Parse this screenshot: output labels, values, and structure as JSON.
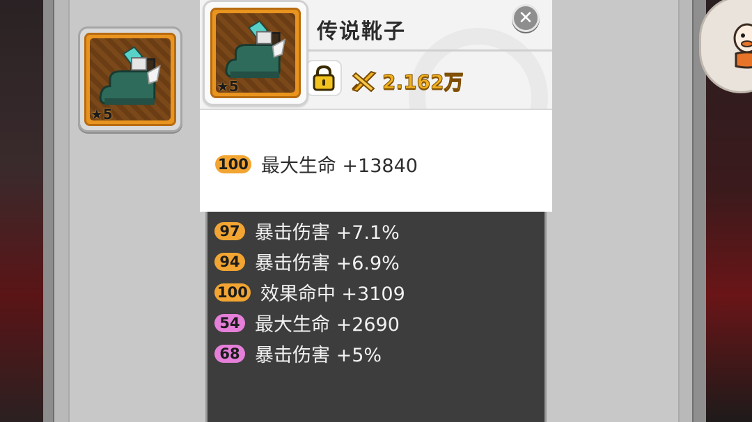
{
  "item": {
    "title": "传说靴子",
    "star_label": "★5",
    "icon": "legendary-boots-icon",
    "power_value": "2.162万"
  },
  "inventory": {
    "slots": [
      {
        "star_label": "★5",
        "icon": "legendary-boots-icon"
      }
    ]
  },
  "main_stat": {
    "level": "100",
    "text": "最大生命 +13840",
    "badge_color": "#f2a532"
  },
  "sub_stats": [
    {
      "level": "97",
      "text": "暴击伤害 +7.1%",
      "badge_color": "#f2a532"
    },
    {
      "level": "94",
      "text": "暴击伤害 +6.9%",
      "badge_color": "#f2a532"
    },
    {
      "level": "100",
      "text": "效果命中 +3109",
      "badge_color": "#f2a532"
    },
    {
      "level": "54",
      "text": "最大生命 +2690",
      "badge_color": "#e57fd9"
    },
    {
      "level": "68",
      "text": "暴击伤害 +5%",
      "badge_color": "#e57fd9"
    }
  ],
  "icons": {
    "close": "close-icon",
    "lock": "lock-icon",
    "power": "sword-power-icon",
    "avatar": "character-avatar-icon"
  }
}
